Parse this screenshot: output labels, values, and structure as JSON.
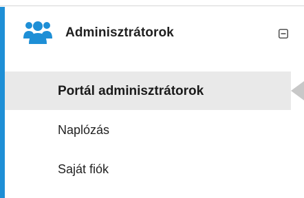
{
  "header": {
    "icon": "users-icon",
    "label": "Adminisztrátorok",
    "toggle_icon": "collapse-minus-icon"
  },
  "menu": {
    "items": [
      {
        "label": "Portál adminisztrátorok",
        "active": true
      },
      {
        "label": "Naplózás",
        "active": false
      },
      {
        "label": "Saját fiók",
        "active": false
      }
    ]
  },
  "colors": {
    "accent": "#1e8fd6",
    "active_bg": "#e9e9e9",
    "pointer": "#c8c8c8",
    "text": "#1f1f1f"
  }
}
